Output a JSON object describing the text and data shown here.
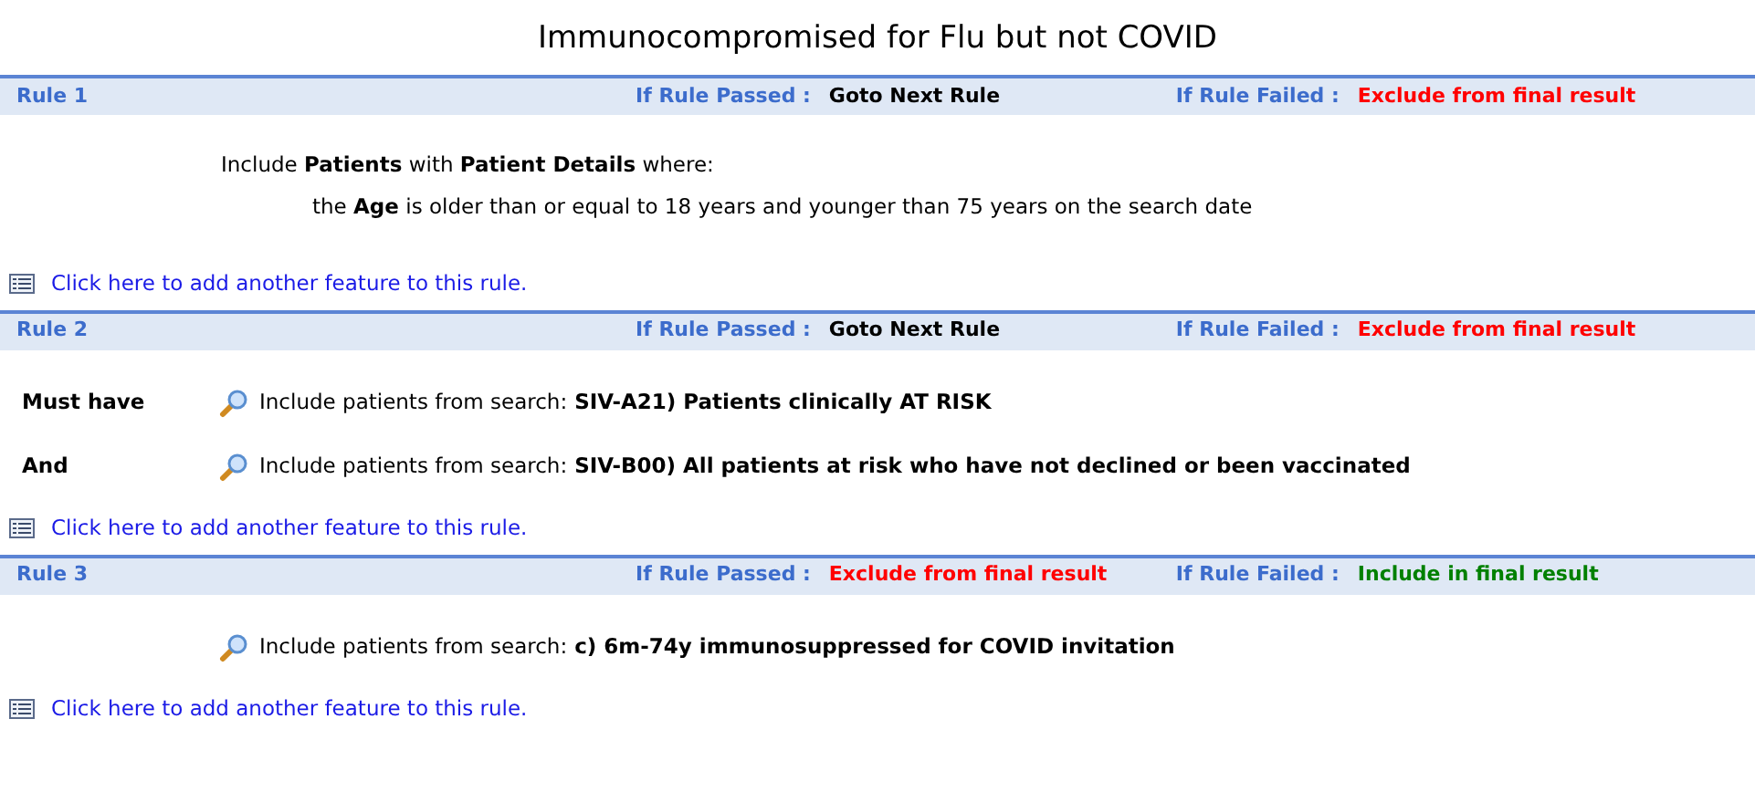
{
  "title": "Immunocompromised for Flu but not COVID",
  "rules": [
    {
      "name": "Rule 1",
      "passed_label": "If Rule Passed :",
      "passed_action": {
        "text": "Goto Next Rule",
        "color": "#000000"
      },
      "failed_label": "If Rule Failed :",
      "failed_action": {
        "text": "Exclude from final result",
        "color": "#ff0000"
      },
      "features": [
        {
          "kind": "criteria",
          "lines": [
            "Include **Patients** with **Patient Details** where:",
            "the **Age** is older than or equal to 18 years and younger than 75 years on the search date"
          ]
        }
      ],
      "add_link": "Click here to add another feature to this rule."
    },
    {
      "name": "Rule 2",
      "passed_label": "If Rule Passed :",
      "passed_action": {
        "text": "Goto Next Rule",
        "color": "#000000"
      },
      "failed_label": "If Rule Failed :",
      "failed_action": {
        "text": "Exclude from final result",
        "color": "#ff0000"
      },
      "features": [
        {
          "kind": "search",
          "qualifier": "Must have",
          "prefix": "Include patients from search:",
          "search": "SIV-A21) Patients clinically AT RISK"
        },
        {
          "kind": "search",
          "qualifier": "And",
          "prefix": "Include patients from search:",
          "search": "SIV-B00) All patients at risk who have not declined or been vaccinated"
        }
      ],
      "add_link": "Click here to add another feature to this rule."
    },
    {
      "name": "Rule 3",
      "passed_label": "If Rule Passed :",
      "passed_action": {
        "text": "Exclude from final result",
        "color": "#ff0000"
      },
      "failed_label": "If Rule Failed :",
      "failed_action": {
        "text": "Include in final result",
        "color": "#008000"
      },
      "features": [
        {
          "kind": "search",
          "prefix": "Include patients from search:",
          "search": "c) 6m-74y immunosuppressed for COVID invitation"
        }
      ],
      "add_link": "Click here to add another feature to this rule."
    }
  ]
}
